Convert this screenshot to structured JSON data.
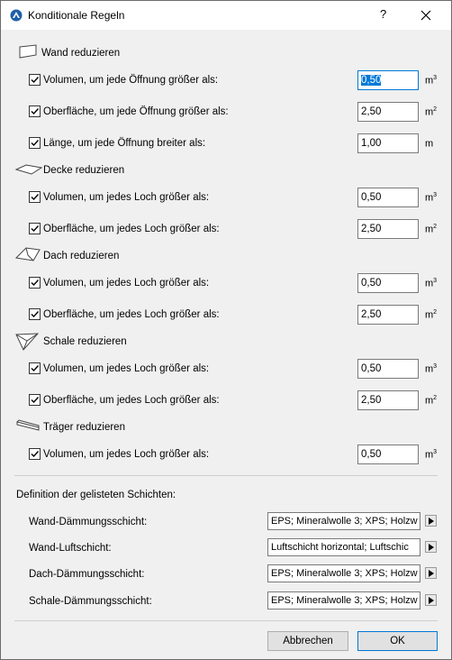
{
  "window": {
    "title": "Konditionale Regeln",
    "help_label": "?"
  },
  "sections": {
    "wand": {
      "label": "Wand reduzieren",
      "rows": [
        {
          "label": "Volumen, um jede Öffnung größer als:",
          "value": "0,50",
          "unit_base": "m",
          "unit_exp": "3"
        },
        {
          "label": "Oberfläche, um jede Öffnung größer als:",
          "value": "2,50",
          "unit_base": "m",
          "unit_exp": "2"
        },
        {
          "label": "Länge, um jede Öffnung breiter als:",
          "value": "1,00",
          "unit_base": "m",
          "unit_exp": ""
        }
      ]
    },
    "decke": {
      "label": "Decke reduzieren",
      "rows": [
        {
          "label": "Volumen, um jedes Loch größer als:",
          "value": "0,50",
          "unit_base": "m",
          "unit_exp": "3"
        },
        {
          "label": "Oberfläche, um jedes Loch größer als:",
          "value": "2,50",
          "unit_base": "m",
          "unit_exp": "2"
        }
      ]
    },
    "dach": {
      "label": "Dach reduzieren",
      "rows": [
        {
          "label": "Volumen, um jedes Loch größer als:",
          "value": "0,50",
          "unit_base": "m",
          "unit_exp": "3"
        },
        {
          "label": "Oberfläche, um jedes Loch größer als:",
          "value": "2,50",
          "unit_base": "m",
          "unit_exp": "2"
        }
      ]
    },
    "schale": {
      "label": "Schale reduzieren",
      "rows": [
        {
          "label": "Volumen, um jedes Loch größer als:",
          "value": "0,50",
          "unit_base": "m",
          "unit_exp": "3"
        },
        {
          "label": "Oberfläche, um jedes Loch größer als:",
          "value": "2,50",
          "unit_base": "m",
          "unit_exp": "2"
        }
      ]
    },
    "traeger": {
      "label": "Träger reduzieren",
      "rows": [
        {
          "label": "Volumen, um jedes Loch größer als:",
          "value": "0,50",
          "unit_base": "m",
          "unit_exp": "3"
        }
      ]
    }
  },
  "definitions": {
    "title": "Definition der gelisteten Schichten:",
    "rows": [
      {
        "label": "Wand-Dämmungsschicht:",
        "value": "EPS; Mineralwolle 3; XPS; Holzw"
      },
      {
        "label": "Wand-Luftschicht:",
        "value": "Luftschicht horizontal; Luftschic"
      },
      {
        "label": "Dach-Dämmungsschicht:",
        "value": "EPS; Mineralwolle 3; XPS; Holzw"
      },
      {
        "label": "Schale-Dämmungsschicht:",
        "value": "EPS; Mineralwolle 3; XPS; Holzw"
      }
    ]
  },
  "buttons": {
    "cancel": "Abbrechen",
    "ok": "OK"
  },
  "colors": {
    "accent": "#0078d7",
    "dialog_bg": "#f0f0f0"
  }
}
